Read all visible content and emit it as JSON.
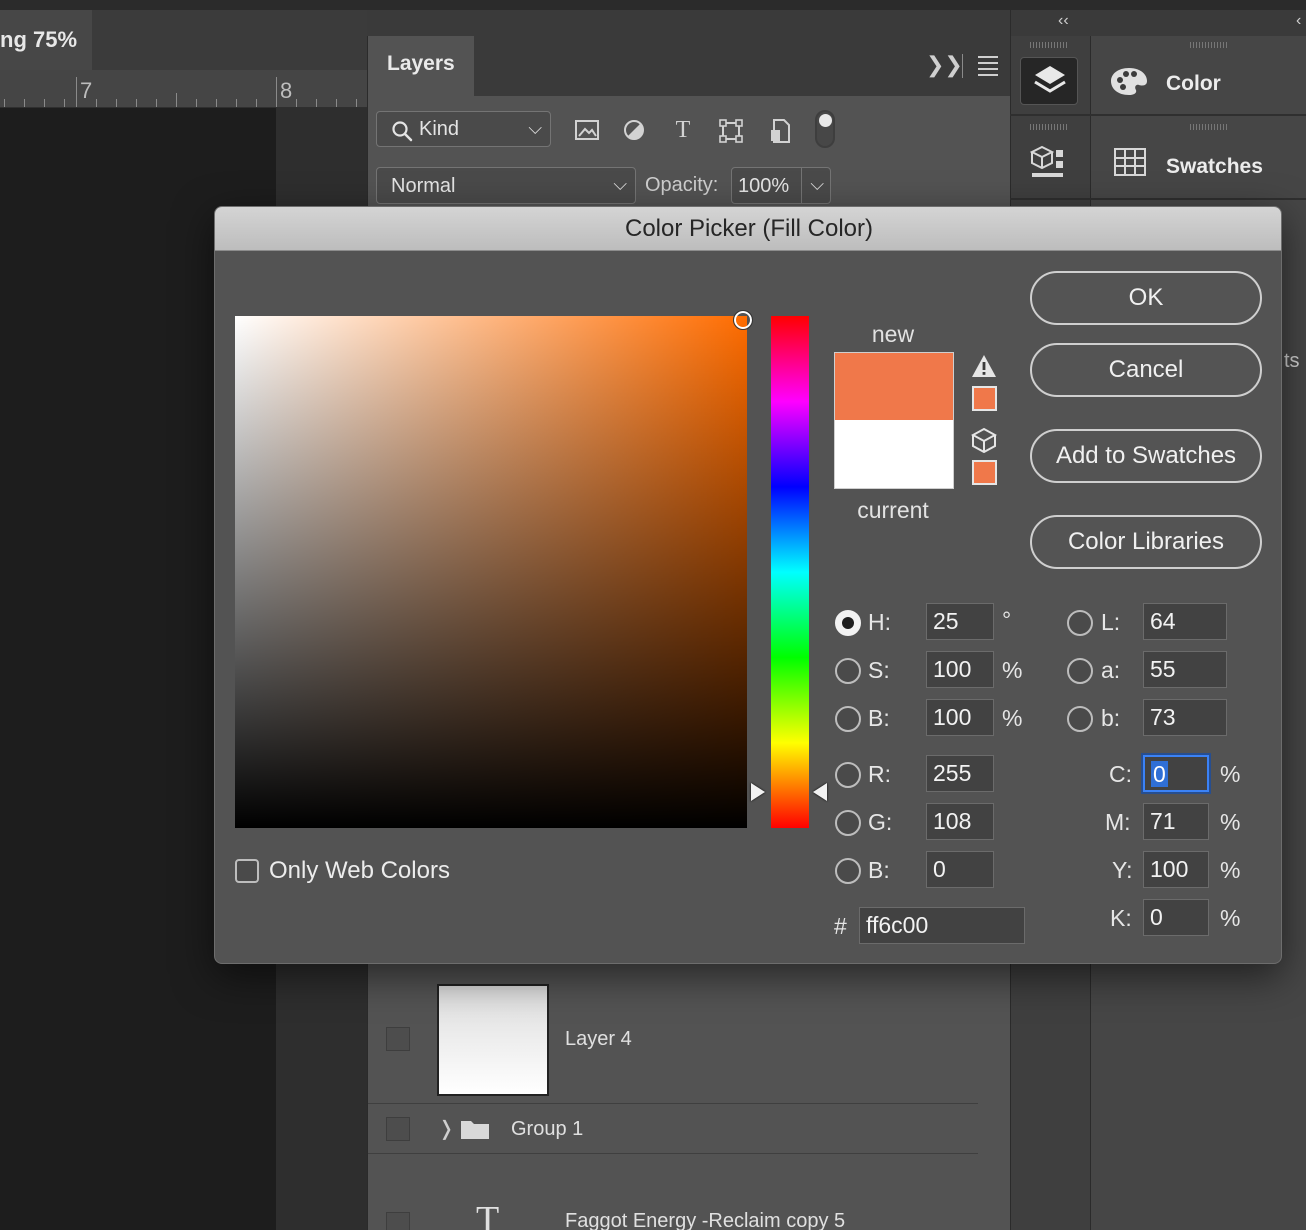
{
  "document": {
    "tab_title": "ng 75%",
    "ruler_marks": [
      "7",
      "8"
    ]
  },
  "layers_panel": {
    "title": "Layers",
    "filter": {
      "kind_label": "Kind"
    },
    "blend_mode": "Normal",
    "opacity_label": "Opacity:",
    "opacity_value": "100%",
    "layers": [
      {
        "name": "Layer 4"
      },
      {
        "name": "Group 1"
      },
      {
        "name": "Faggot Energy -Reclaim copy 5"
      }
    ]
  },
  "dock": {
    "color_panel_label": "Color",
    "swatches_panel_label": "Swatches",
    "hidden_fragment": "ts"
  },
  "color_picker": {
    "title": "Color Picker (Fill Color)",
    "new_label": "new",
    "current_label": "current",
    "new_color": "#f0784a",
    "current_color": "#ffffff",
    "buttons": {
      "ok": "OK",
      "cancel": "Cancel",
      "add_to_swatches": "Add to Swatches",
      "color_libraries": "Color Libraries"
    },
    "hsb": {
      "h_label": "H:",
      "h_value": "25",
      "h_unit": "°",
      "s_label": "S:",
      "s_value": "100",
      "s_unit": "%",
      "b_label": "B:",
      "b_value": "100",
      "b_unit": "%"
    },
    "rgb": {
      "r_label": "R:",
      "r_value": "255",
      "g_label": "G:",
      "g_value": "108",
      "b_label": "B:",
      "b_value": "0"
    },
    "lab": {
      "l_label": "L:",
      "l_value": "64",
      "a_label": "a:",
      "a_value": "55",
      "b_label": "b:",
      "b_value": "73"
    },
    "cmyk": {
      "c_label": "C:",
      "c_value": "0",
      "m_label": "M:",
      "m_value": "71",
      "y_label": "Y:",
      "y_value": "100",
      "k_label": "K:",
      "k_value": "0",
      "unit": "%"
    },
    "hex_label": "#",
    "hex_value": "ff6c00",
    "only_web_colors_label": "Only Web Colors"
  }
}
